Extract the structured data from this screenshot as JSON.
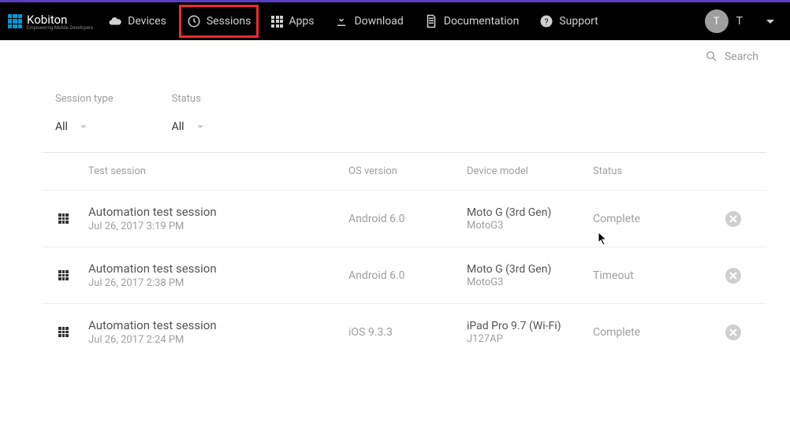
{
  "brand": {
    "name": "Kobiton",
    "tagline": "Empowering Mobile Developers"
  },
  "nav": {
    "devices": "Devices",
    "sessions": "Sessions",
    "apps": "Apps",
    "download": "Download",
    "documentation": "Documentation",
    "support": "Support"
  },
  "user": {
    "initial": "T",
    "name": "T"
  },
  "search": {
    "label": "Search"
  },
  "filters": {
    "session_type_label": "Session type",
    "session_type_value": "All",
    "status_label": "Status",
    "status_value": "All"
  },
  "columns": {
    "test_session": "Test session",
    "os_version": "OS version",
    "device_model": "Device model",
    "status": "Status"
  },
  "sessions": [
    {
      "name": "Automation test session",
      "date": "Jul 26, 2017 3:19 PM",
      "os": "Android 6.0",
      "model": "Moto G (3rd Gen)",
      "model_code": "MotoG3",
      "status": "Complete"
    },
    {
      "name": "Automation test session",
      "date": "Jul 26, 2017 2:38 PM",
      "os": "Android 6.0",
      "model": "Moto G (3rd Gen)",
      "model_code": "MotoG3",
      "status": "Timeout"
    },
    {
      "name": "Automation test session",
      "date": "Jul 26, 2017 2:24 PM",
      "os": "iOS 9.3.3",
      "model": "iPad Pro 9.7 (Wi-Fi)",
      "model_code": "J127AP",
      "status": "Complete"
    }
  ]
}
